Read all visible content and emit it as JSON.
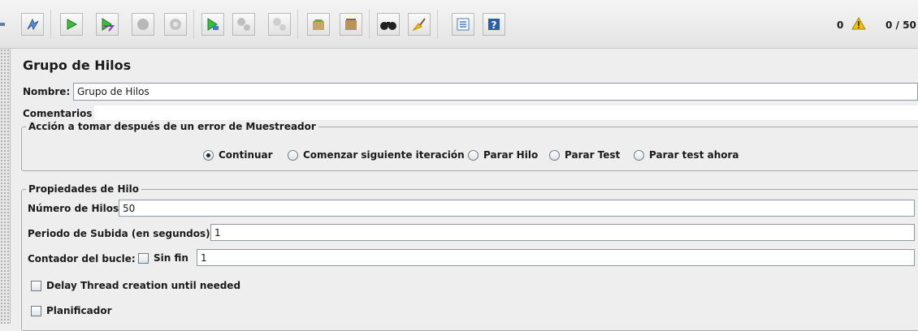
{
  "toolbar": {
    "icons": [
      "expand-handle-icon",
      "toggle-icon",
      "start-icon",
      "start-no-pauses-icon",
      "stop-icon",
      "shutdown-icon",
      "remote-start-icon",
      "remote-stop-icon",
      "remote-shutdown-icon",
      "clear-icon",
      "clear-all-icon",
      "search-icon",
      "reset-search-icon",
      "function-helper-icon",
      "help-icon"
    ],
    "error_count": "0",
    "active_threads": "0 / 50"
  },
  "panel": {
    "title": "Grupo de Hilos",
    "name_label": "Nombre:",
    "name_value": "Grupo de Hilos",
    "comments_label": "Comentarios",
    "error_action": {
      "legend": "Acción a tomar después de un error de Muestreador",
      "options": [
        "Continuar",
        "Comenzar siguiente iteración",
        "Parar Hilo",
        "Parar Test",
        "Parar test ahora"
      ],
      "selected": "Continuar"
    },
    "thread_props": {
      "legend": "Propiedades de Hilo",
      "threads_label": "Número de Hilos",
      "threads_value": "50",
      "rampup_label": "Periodo de Subida (en segundos):",
      "rampup_value": "1",
      "loop_label": "Contador del bucle:",
      "forever_label": "Sin fin",
      "loop_value": "1",
      "delay_label": "Delay Thread creation until needed",
      "scheduler_label": "Planificador"
    }
  },
  "colors": {
    "accent": "#4a7ab8",
    "warning": "#f2c200",
    "panel_bg": "#eeeeee"
  }
}
